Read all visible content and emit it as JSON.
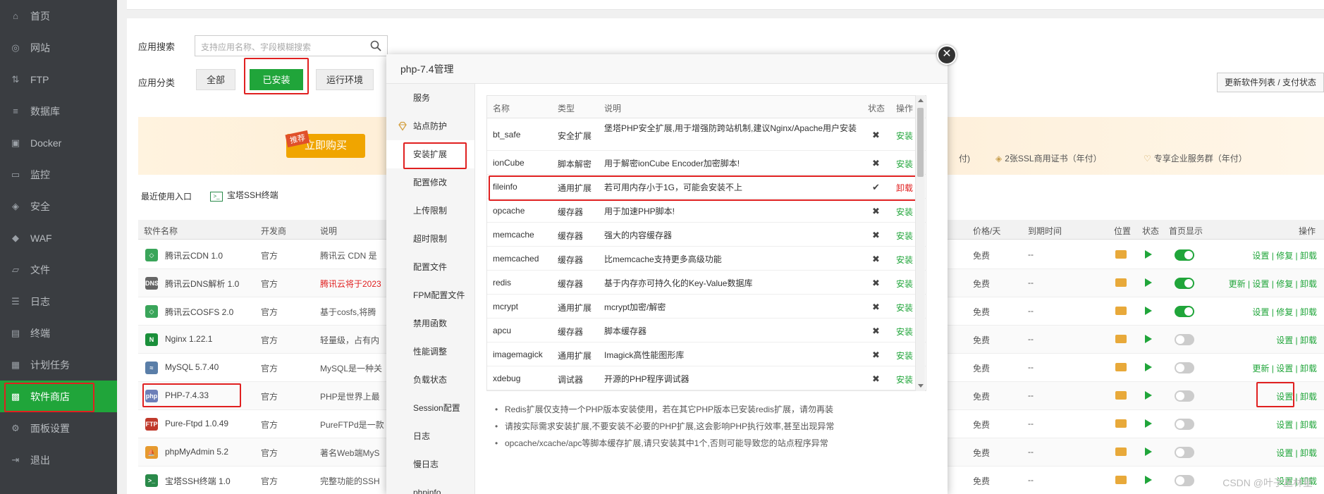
{
  "sidebar": {
    "items": [
      {
        "label": "首页",
        "icon": "home-icon",
        "glyph": "⌂"
      },
      {
        "label": "网站",
        "icon": "globe-icon",
        "glyph": "◎"
      },
      {
        "label": "FTP",
        "icon": "ftp-icon",
        "glyph": "⇅"
      },
      {
        "label": "数据库",
        "icon": "database-icon",
        "glyph": "≡"
      },
      {
        "label": "Docker",
        "icon": "docker-icon",
        "glyph": "▣"
      },
      {
        "label": "监控",
        "icon": "monitor-icon",
        "glyph": "▭"
      },
      {
        "label": "安全",
        "icon": "shield-icon",
        "glyph": "◈"
      },
      {
        "label": "WAF",
        "icon": "waf-icon",
        "glyph": "◆"
      },
      {
        "label": "文件",
        "icon": "folder-icon",
        "glyph": "▱"
      },
      {
        "label": "日志",
        "icon": "log-icon",
        "glyph": "☰"
      },
      {
        "label": "终端",
        "icon": "terminal-icon",
        "glyph": "▤"
      },
      {
        "label": "计划任务",
        "icon": "calendar-icon",
        "glyph": "▦"
      },
      {
        "label": "软件商店",
        "icon": "grid-icon",
        "glyph": "▩"
      },
      {
        "label": "面板设置",
        "icon": "gear-icon",
        "glyph": "⚙"
      },
      {
        "label": "退出",
        "icon": "logout-icon",
        "glyph": "⇥"
      }
    ],
    "active_index": 12
  },
  "store": {
    "search_label": "应用搜索",
    "search_placeholder": "支持应用名称、字段模糊搜索",
    "category_label": "应用分类",
    "categories": [
      "全部",
      "已安装",
      "运行环境"
    ],
    "active_category": 1,
    "update_button": "更新软件列表 / 支付状态",
    "buy_button": "立即购买",
    "hot_tag": "推荐",
    "perks": [
      "付)",
      "2张SSL商用证书（年付）",
      "专享企业服务群（年付）"
    ],
    "recent_label": "最近使用入口",
    "recent_app": "宝塔SSH终端",
    "table_headers": {
      "name": "软件名称",
      "dev": "开发商",
      "desc": "说明",
      "price": "价格/天",
      "expire": "到期时间",
      "location": "位置",
      "status": "状态",
      "home": "首页显示",
      "ops": "操作"
    },
    "rows": [
      {
        "name": "腾讯云CDN 1.0",
        "dev": "官方",
        "desc": "腾讯云 CDN 是",
        "price": "免费",
        "expire": "--",
        "home": true,
        "ops": "设置 | 修复 | 卸载",
        "ico": "#3aa55a",
        "icotext": "◇"
      },
      {
        "name": "腾讯云DNS解析 1.0",
        "dev": "官方",
        "desc": "腾讯云将于2023",
        "price": "免费",
        "expire": "--",
        "home": true,
        "ops": "更新 | 设置 | 修复 | 卸载",
        "ico": "#666",
        "icotext": "DNS",
        "desc_red": true
      },
      {
        "name": "腾讯云COSFS 2.0",
        "dev": "官方",
        "desc": "基于cosfs,将腾",
        "price": "免费",
        "expire": "--",
        "home": true,
        "ops": "设置 | 修复 | 卸载",
        "ico": "#3aa55a",
        "icotext": "◇"
      },
      {
        "name": "Nginx 1.22.1",
        "dev": "官方",
        "desc": "轻量级，占有内",
        "price": "免费",
        "expire": "--",
        "home": false,
        "ops": "设置 | 卸载",
        "ico": "#1a8f3a",
        "icotext": "N"
      },
      {
        "name": "MySQL 5.7.40",
        "dev": "官方",
        "desc": "MySQL是一种关",
        "price": "免费",
        "expire": "--",
        "home": false,
        "ops": "更新 | 设置 | 卸载",
        "ico": "#5a7ea8",
        "icotext": "≈"
      },
      {
        "name": "PHP-7.4.33",
        "dev": "官方",
        "desc": "PHP是世界上最",
        "price": "免费",
        "expire": "--",
        "home": false,
        "ops": "设置 | 卸载",
        "ico": "#6d7fb8",
        "icotext": "php"
      },
      {
        "name": "Pure-Ftpd 1.0.49",
        "dev": "官方",
        "desc": "PureFTPd是一款",
        "price": "免费",
        "expire": "--",
        "home": false,
        "ops": "设置 | 卸载",
        "ico": "#c0392b",
        "icotext": "FTP"
      },
      {
        "name": "phpMyAdmin 5.2",
        "dev": "官方",
        "desc": "著名Web端MyS",
        "price": "免费",
        "expire": "--",
        "home": false,
        "ops": "设置 | 卸载",
        "ico": "#e69a2e",
        "icotext": "⛵"
      },
      {
        "name": "宝塔SSH终端 1.0",
        "dev": "官方",
        "desc": "完整功能的SSH",
        "price": "免费",
        "expire": "--",
        "home": false,
        "ops": "设置 | 卸载",
        "ico": "#2a8a4a",
        "icotext": ">_"
      }
    ]
  },
  "modal": {
    "title": "php-7.4管理",
    "close_glyph": "✕",
    "nav": [
      "服务",
      "站点防护",
      "安装扩展",
      "配置修改",
      "上传限制",
      "超时限制",
      "配置文件",
      "FPM配置文件",
      "禁用函数",
      "性能调整",
      "负载状态",
      "Session配置",
      "日志",
      "慢日志",
      "phpinfo"
    ],
    "active_nav": 2,
    "ext_headers": {
      "name": "名称",
      "type": "类型",
      "desc": "说明",
      "status": "状态",
      "op": "操作"
    },
    "extensions": [
      {
        "name": "bt_safe",
        "type": "安全扩展",
        "desc": "堡塔PHP安全扩展,用于增强防跨站机制,建议Nginx/Apache用户安装",
        "status": "✖",
        "op": "安装",
        "tall": true
      },
      {
        "name": "ionCube",
        "type": "脚本解密",
        "desc": "用于解密ionCube Encoder加密脚本!",
        "status": "✖",
        "op": "安装"
      },
      {
        "name": "fileinfo",
        "type": "通用扩展",
        "desc": "若可用内存小于1G，可能会安装不上",
        "status": "✔",
        "op": "卸载",
        "installed": true
      },
      {
        "name": "opcache",
        "type": "缓存器",
        "desc": "用于加速PHP脚本!",
        "status": "✖",
        "op": "安装"
      },
      {
        "name": "memcache",
        "type": "缓存器",
        "desc": "强大的内容缓存器",
        "status": "✖",
        "op": "安装"
      },
      {
        "name": "memcached",
        "type": "缓存器",
        "desc": "比memcache支持更多高级功能",
        "status": "✖",
        "op": "安装"
      },
      {
        "name": "redis",
        "type": "缓存器",
        "desc": "基于内存亦可持久化的Key-Value数据库",
        "status": "✖",
        "op": "安装"
      },
      {
        "name": "mcrypt",
        "type": "通用扩展",
        "desc": "mcrypt加密/解密",
        "status": "✖",
        "op": "安装"
      },
      {
        "name": "apcu",
        "type": "缓存器",
        "desc": "脚本缓存器",
        "status": "✖",
        "op": "安装"
      },
      {
        "name": "imagemagick",
        "type": "通用扩展",
        "desc": "Imagick高性能图形库",
        "status": "✖",
        "op": "安装"
      },
      {
        "name": "xdebug",
        "type": "调试器",
        "desc": "开源的PHP程序调试器",
        "status": "✖",
        "op": "安装"
      }
    ],
    "notes": [
      "Redis扩展仅支持一个PHP版本安装使用，若在其它PHP版本已安装redis扩展，请勿再装",
      "请按实际需求安装扩展,不要安装不必要的PHP扩展,这会影响PHP执行效率,甚至出现异常",
      "opcache/xcache/apc等脚本缓存扩展,请只安装其中1个,否则可能导致您的站点程序异常"
    ]
  },
  "watermark": "CSDN @叶子丛林星",
  "colors": {
    "brand_green": "#20a53a",
    "highlight_red": "#e02020",
    "sidebar_bg": "#3a3d41"
  }
}
